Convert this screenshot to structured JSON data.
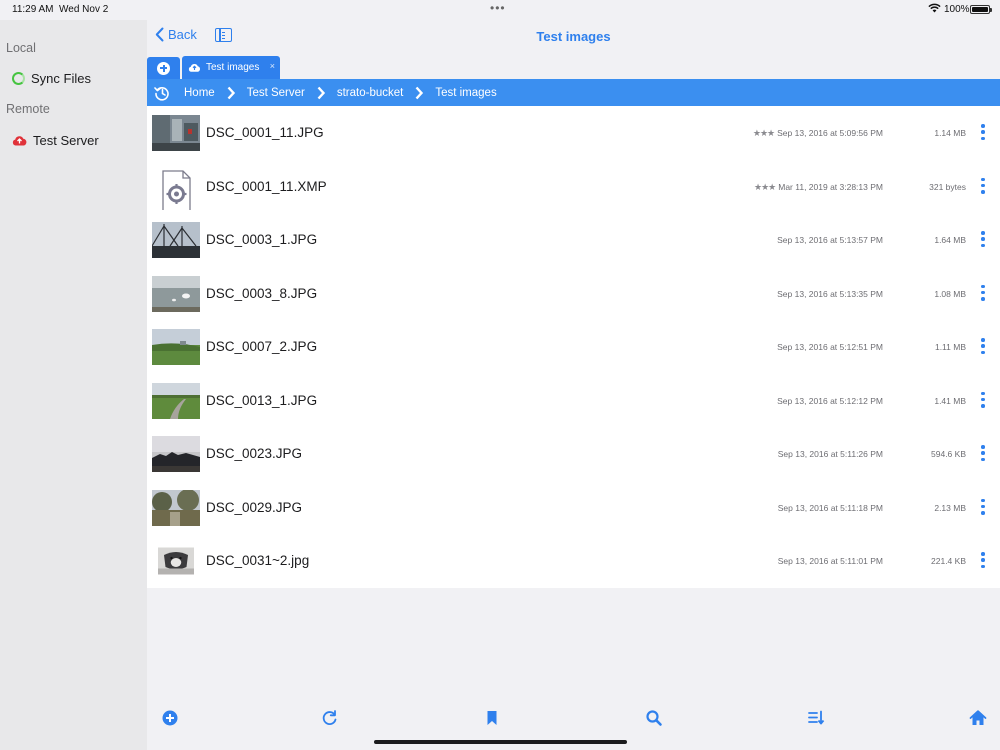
{
  "status_bar": {
    "time": "11:29 AM",
    "date": "Wed Nov 2",
    "battery": "100%"
  },
  "sidebar": {
    "local_header": "Local",
    "local_items": [
      {
        "label": "Sync Files",
        "icon": "sync-icon"
      }
    ],
    "remote_header": "Remote",
    "remote_items": [
      {
        "label": "Test Server",
        "icon": "cloud-server-icon"
      }
    ]
  },
  "navbar": {
    "back_label": "Back",
    "title": "Test images"
  },
  "tabs": [
    {
      "label": "Test images",
      "close": "×"
    }
  ],
  "breadcrumb": [
    "Home",
    "Test Server",
    "strato-bucket",
    "Test images"
  ],
  "files": [
    {
      "name": "DSC_0001_11.JPG",
      "stars": "★★★",
      "date": "Sep 13, 2016 at 5:09:56 PM",
      "size": "1.14 MB",
      "thumb": "photo-street"
    },
    {
      "name": "DSC_0001_11.XMP",
      "stars": "★★★",
      "date": "Mar 11, 2019 at 3:28:13 PM",
      "size": "321 bytes",
      "thumb": "xmp-file-icon"
    },
    {
      "name": "DSC_0003_1.JPG",
      "stars": "",
      "date": "Sep 13, 2016 at 5:13:57 PM",
      "size": "1.64 MB",
      "thumb": "photo-ship"
    },
    {
      "name": "DSC_0003_8.JPG",
      "stars": "",
      "date": "Sep 13, 2016 at 5:13:35 PM",
      "size": "1.08 MB",
      "thumb": "photo-water"
    },
    {
      "name": "DSC_0007_2.JPG",
      "stars": "",
      "date": "Sep 13, 2016 at 5:12:51 PM",
      "size": "1.11 MB",
      "thumb": "photo-meadow"
    },
    {
      "name": "DSC_0013_1.JPG",
      "stars": "",
      "date": "Sep 13, 2016 at 5:12:12 PM",
      "size": "1.41 MB",
      "thumb": "photo-path"
    },
    {
      "name": "DSC_0023.JPG",
      "stars": "",
      "date": "Sep 13, 2016 at 5:11:26 PM",
      "size": "594.6 KB",
      "thumb": "photo-dusk"
    },
    {
      "name": "DSC_0029.JPG",
      "stars": "",
      "date": "Sep 13, 2016 at 5:11:18 PM",
      "size": "2.13 MB",
      "thumb": "photo-garden"
    },
    {
      "name": "DSC_0031~2.jpg",
      "stars": "",
      "date": "Sep 13, 2016 at 5:11:01 PM",
      "size": "221.4 KB",
      "thumb": "photo-dog"
    }
  ],
  "toolbar": [
    "add-icon",
    "refresh-icon",
    "bookmark-icon",
    "search-icon",
    "sort-icon",
    "home-icon"
  ],
  "colors": {
    "accent": "#2f80ed",
    "breadcrumb_bg": "#3b8ff0",
    "sidebar_bg": "#e8e8ea"
  }
}
